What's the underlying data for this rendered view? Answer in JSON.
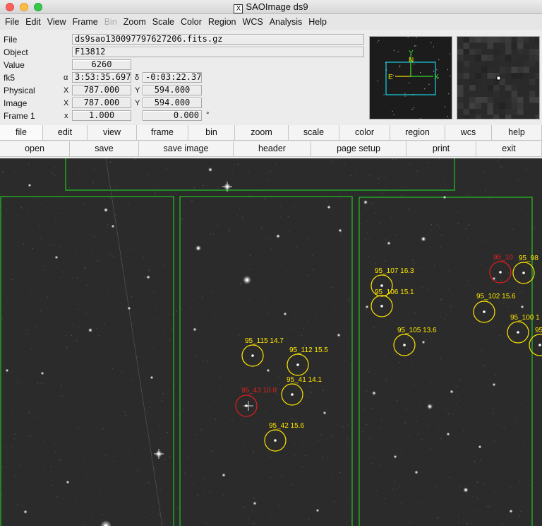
{
  "window": {
    "title": "SAOImage ds9"
  },
  "menu": [
    "File",
    "Edit",
    "View",
    "Frame",
    "Bin",
    "Zoom",
    "Scale",
    "Color",
    "Region",
    "WCS",
    "Analysis",
    "Help"
  ],
  "menu_disabled": [
    "Bin"
  ],
  "info": {
    "file_label": "File",
    "file_value": "ds9sao130097797627206.fits.gz",
    "object_label": "Object",
    "object_value": "F13812",
    "value_label": "Value",
    "value_value": "6260",
    "fk5_label": "fk5",
    "alpha": "α",
    "ra": "3:53:35.697",
    "delta": "δ",
    "dec": "-0:03:22.37",
    "physical_label": "Physical",
    "physical_x_label": "X",
    "physical_x": "787.000",
    "physical_y_label": "Y",
    "physical_y": "594.000",
    "image_label": "Image",
    "image_x_label": "X",
    "image_x": "787.000",
    "image_y_label": "Y",
    "image_y": "594.000",
    "frame_label": "Frame 1",
    "frame_x_label": "x",
    "frame_zoom": "1.000",
    "frame_angle": "0.000",
    "degree": "°"
  },
  "panner": {
    "north": "N",
    "east": "E",
    "x_axis": "X",
    "y_axis": "Y"
  },
  "buttons_row1": [
    "file",
    "edit",
    "view",
    "frame",
    "bin",
    "zoom",
    "scale",
    "color",
    "region",
    "wcs",
    "help"
  ],
  "buttons_row2": [
    "open",
    "save",
    "save image",
    "header",
    "page setup",
    "print",
    "exit"
  ],
  "colors": {
    "region_green": "#22c322",
    "yellow": "#ffe600",
    "red": "#e0201f",
    "background": "#2b2b2b"
  },
  "regions": [
    {
      "label": "95_107 16.3",
      "color": "yellow"
    },
    {
      "label": "95_106 15.1",
      "color": "yellow"
    },
    {
      "label": "95_102 15.6",
      "color": "yellow"
    },
    {
      "label": "95_105 13.6",
      "color": "yellow"
    },
    {
      "label": "95_115 14.7",
      "color": "yellow"
    },
    {
      "label": "95_112 15.5",
      "color": "yellow"
    },
    {
      "label": "95_41 14.1",
      "color": "yellow"
    },
    {
      "label": "95_43 10.8",
      "color": "red"
    },
    {
      "label": "95_42 15.6",
      "color": "yellow"
    },
    {
      "label": "95_10",
      "color": "red"
    },
    {
      "label": "95_98",
      "color": "yellow"
    },
    {
      "label": "95_100 1",
      "color": "yellow"
    },
    {
      "label": "95",
      "color": "yellow"
    }
  ]
}
